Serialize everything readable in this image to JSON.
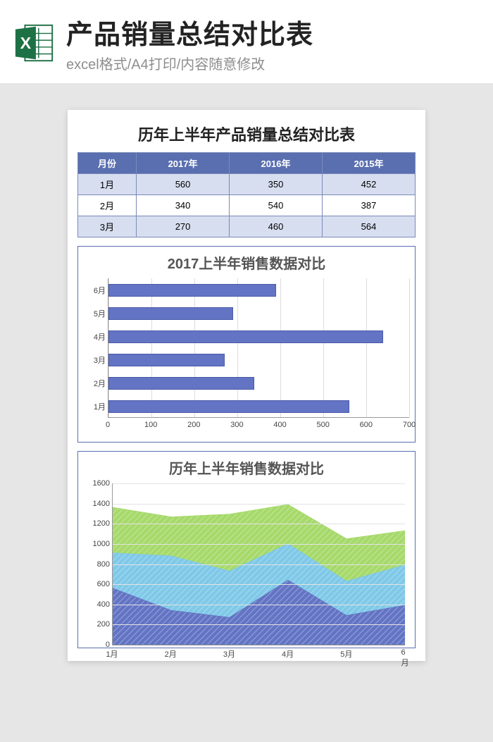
{
  "header": {
    "title": "产品销量总结对比表",
    "subtitle": "excel格式/A4打印/内容随意修改"
  },
  "sheet": {
    "title": "历年上半年产品销量总结对比表",
    "table": {
      "headers": [
        "月份",
        "2017年",
        "2016年",
        "2015年"
      ],
      "rows": [
        [
          "1月",
          "560",
          "350",
          "452"
        ],
        [
          "2月",
          "340",
          "540",
          "387"
        ],
        [
          "3月",
          "270",
          "460",
          "564"
        ]
      ]
    }
  },
  "chart_data": [
    {
      "type": "bar",
      "orientation": "horizontal",
      "title": "2017上半年销售数据对比",
      "categories": [
        "1月",
        "2月",
        "3月",
        "4月",
        "5月",
        "6月"
      ],
      "values": [
        560,
        340,
        270,
        640,
        290,
        390
      ],
      "xlim": [
        0,
        700
      ],
      "xticks": [
        0,
        100,
        200,
        300,
        400,
        500,
        600,
        700
      ]
    },
    {
      "type": "area",
      "stacked": true,
      "title": "历年上半年销售数据对比",
      "categories": [
        "1月",
        "2月",
        "3月",
        "4月",
        "5月",
        "6月"
      ],
      "series": [
        {
          "name": "2017年",
          "values": [
            560,
            340,
            270,
            640,
            290,
            390
          ],
          "color": "#6374c4"
        },
        {
          "name": "2016年",
          "values": [
            350,
            540,
            460,
            360,
            340,
            400
          ],
          "color": "#7fc8e8"
        },
        {
          "name": "2015年",
          "values": [
            452,
            387,
            564,
            390,
            420,
            340
          ],
          "color": "#a6d96a"
        }
      ],
      "ylim": [
        0,
        1600
      ],
      "yticks": [
        0,
        200,
        400,
        600,
        800,
        1000,
        1200,
        1400,
        1600
      ]
    }
  ]
}
